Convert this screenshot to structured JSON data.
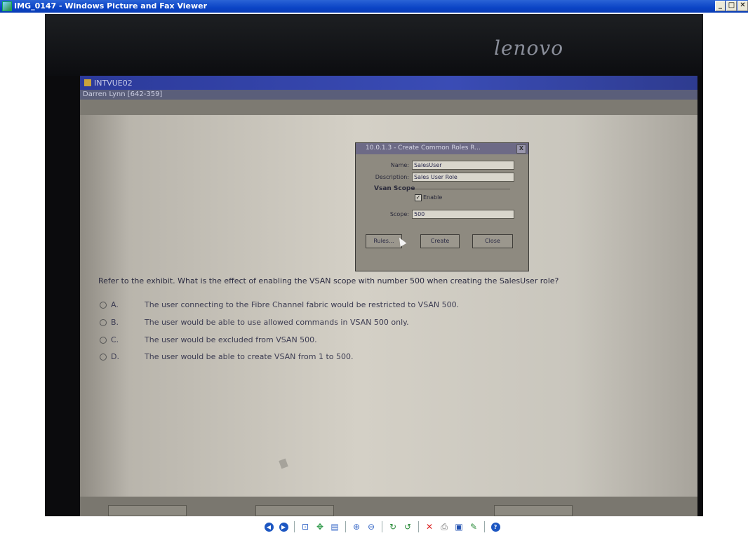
{
  "window": {
    "title": "IMG_0147 - Windows Picture and Fax Viewer",
    "minimize": "_",
    "maximize": "□",
    "close": "✕"
  },
  "photo": {
    "brand": "lenovo",
    "app_title": "INTVUE02",
    "user": "Darren Lynn [642-359]",
    "dialog": {
      "title": "10.0.1.3 - Create Common Roles R...",
      "close": "X",
      "name_label": "Name:",
      "name_value": "SalesUser",
      "description_label": "Description:",
      "description_value": "Sales User Role",
      "group_label": "Vsan Scope",
      "enable_label": "Enable",
      "scope_label": "Scope:",
      "scope_value": "500",
      "buttons": [
        "Rules...",
        "Create",
        "Close"
      ]
    },
    "question": "Refer to the exhibit. What is the effect of enabling the VSAN scope with number 500 when creating the SalesUser role?",
    "options": [
      {
        "letter": "A.",
        "text": "The user connecting to the Fibre Channel fabric would be restricted to VSAN 500."
      },
      {
        "letter": "B.",
        "text": "The user would be able to use allowed commands in VSAN 500 only."
      },
      {
        "letter": "C.",
        "text": "The user would be excluded from VSAN 500."
      },
      {
        "letter": "D.",
        "text": "The user would be able to create VSAN from 1 to 500."
      }
    ]
  },
  "toolbar": {
    "icons": [
      "previous-image-icon",
      "next-image-icon",
      "best-fit-icon",
      "actual-size-icon",
      "slideshow-icon",
      "zoom-in-icon",
      "zoom-out-icon",
      "rotate-clockwise-icon",
      "rotate-counterclockwise-icon",
      "delete-icon",
      "print-icon",
      "save-icon",
      "edit-icon",
      "help-icon"
    ]
  }
}
